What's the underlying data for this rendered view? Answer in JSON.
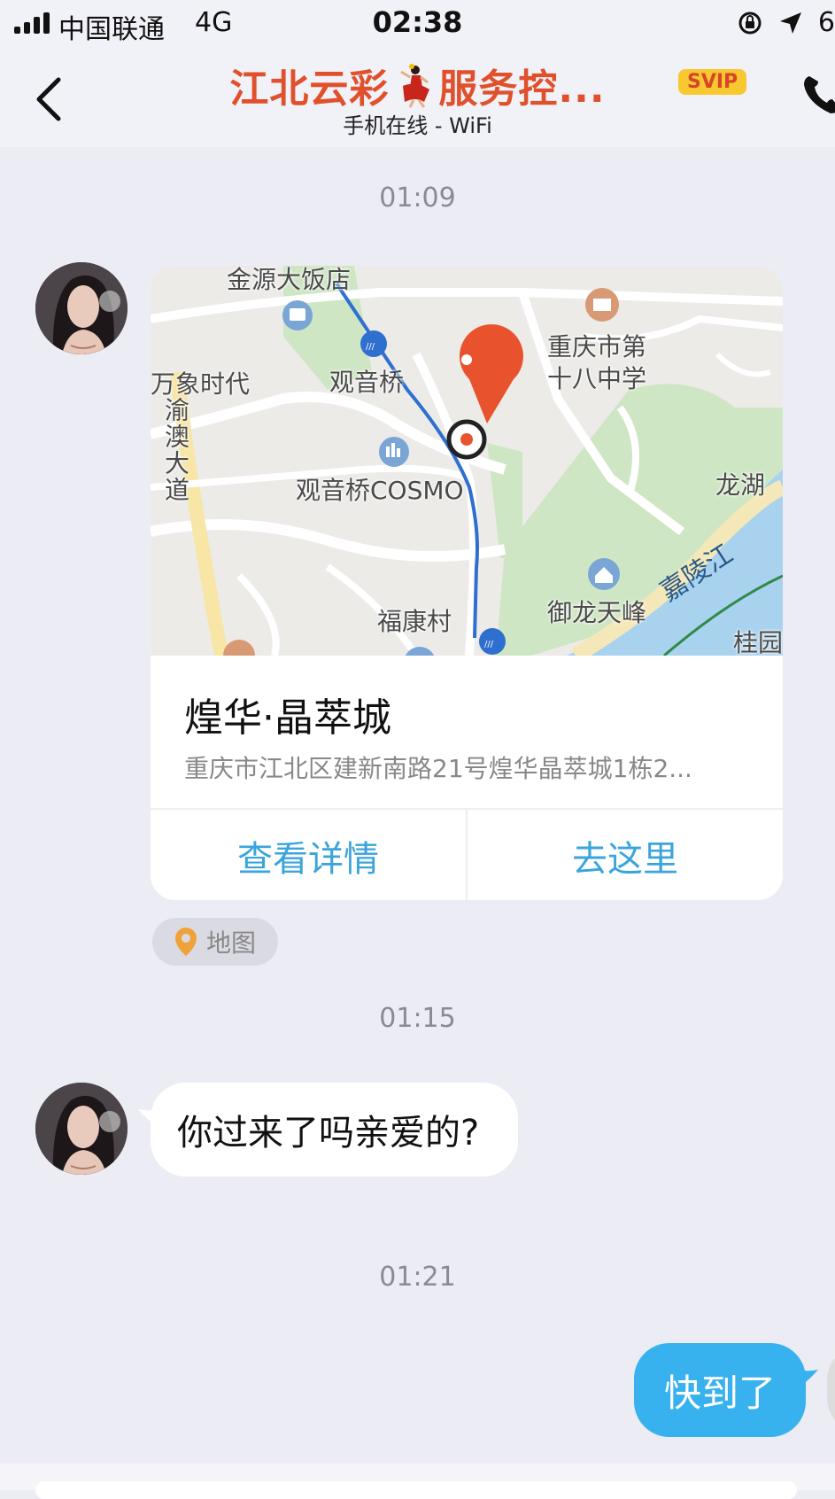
{
  "status_bar": {
    "carrier": "中国联通",
    "network": "4G",
    "time": "02:38",
    "battery_partial": "6"
  },
  "header": {
    "title_part1": "江北云彩",
    "title_part2": "服务控...",
    "badge": "SVIP",
    "subtitle": "手机在线 - WiFi"
  },
  "messages": {
    "ts1": "01:09",
    "ts2": "01:15",
    "ts3": "01:21",
    "location": {
      "place_name": "煌华·晶萃城",
      "address": "重庆市江北区建新南路21号煌华晶萃城1栋2...",
      "btn_details": "查看详情",
      "btn_go": "去这里",
      "tag_label": "地图"
    },
    "incoming_text": "你过来了吗亲爱的?",
    "outgoing_text": "快到了"
  },
  "map_labels": {
    "l1": "金源大饭店",
    "l2": "观音桥",
    "l3": "万象时代",
    "l4": "渝澳大道",
    "l5": "观音桥COSMO",
    "l6": "重庆市第",
    "l7": "十八中学",
    "l8": "龙湖",
    "l9": "御龙天峰",
    "l10": "福康村",
    "l11": "嘉陵江",
    "l12": "桂园"
  },
  "colors": {
    "title": "#e0502b",
    "accent": "#38b2ee",
    "link": "#3aa4dc",
    "pin": "#e8522d"
  }
}
